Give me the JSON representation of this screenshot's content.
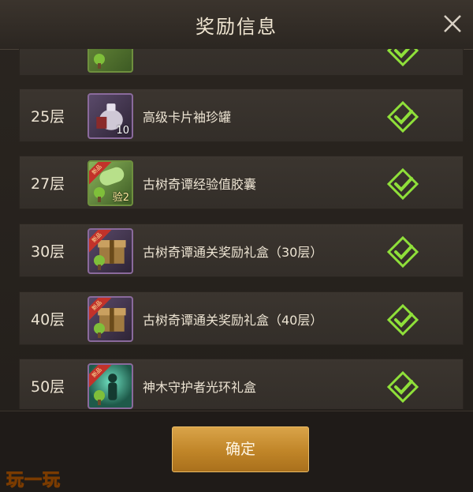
{
  "dialog": {
    "title": "奖励信息",
    "close_icon": "close-icon",
    "confirm_label": "确定"
  },
  "rewards": [
    {
      "floor": "",
      "name": "",
      "qty": "",
      "icon": "green-item-icon",
      "badge": "",
      "status": "claimed-check-icon"
    },
    {
      "floor": "25层",
      "name": "高级卡片袖珍罐",
      "qty": "10",
      "icon": "jar-icon",
      "badge": "",
      "status": "claimed-check-icon"
    },
    {
      "floor": "27层",
      "name": "古树奇谭经验值胶囊",
      "qty": "",
      "icon": "exp-capsule-icon",
      "badge": "新品",
      "icon_text": "验",
      "icon_sub": "2",
      "status": "claimed-check-icon"
    },
    {
      "floor": "30层",
      "name": "古树奇谭通关奖励礼盒（30层）",
      "qty": "",
      "icon": "gift-chest-icon",
      "badge": "新品",
      "status": "claimed-check-icon"
    },
    {
      "floor": "40层",
      "name": "古树奇谭通关奖励礼盒（40层）",
      "qty": "",
      "icon": "gift-chest-icon",
      "badge": "新品",
      "status": "claimed-check-icon"
    },
    {
      "floor": "50层",
      "name": "神木守护者光环礼盒",
      "qty": "",
      "icon": "aura-gift-icon",
      "badge": "新品",
      "status": "claimed-check-icon"
    }
  ],
  "watermark": "玩一玩",
  "colors": {
    "accent_gold": "#c08528",
    "check_green": "#8fe03a",
    "panel": "#2a2520"
  }
}
